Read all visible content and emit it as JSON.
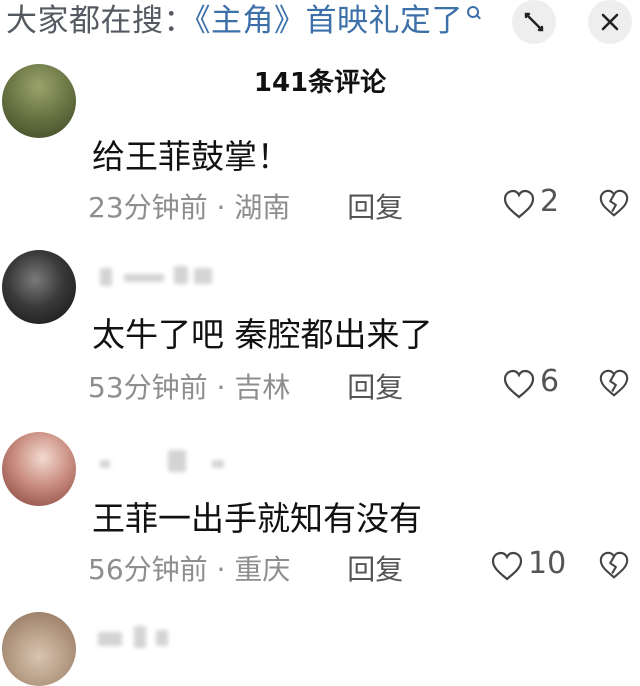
{
  "header": {
    "search_prefix": "大家都在搜：",
    "search_topic": "《主角》首映礼定了",
    "comment_count": "141条评论"
  },
  "icons": {
    "expand": "expand-icon",
    "close": "close-icon",
    "search": "search-icon",
    "heart": "heart-outline-icon",
    "broken_heart": "broken-heart-icon"
  },
  "colors": {
    "link": "#3d6fa8",
    "meta": "#8e8e8e",
    "button_bg": "#eeeeef"
  },
  "comments": [
    {
      "text": "给王菲鼓掌！",
      "time": "23分钟前",
      "location": "湖南",
      "reply": "回复",
      "likes": "2"
    },
    {
      "text": "太牛了吧 秦腔都出来了",
      "time": "53分钟前",
      "location": "吉林",
      "reply": "回复",
      "likes": "6"
    },
    {
      "text": "王菲一出手就知有没有",
      "time": "56分钟前",
      "location": "重庆",
      "reply": "回复",
      "likes": "10"
    }
  ],
  "separator": "·"
}
